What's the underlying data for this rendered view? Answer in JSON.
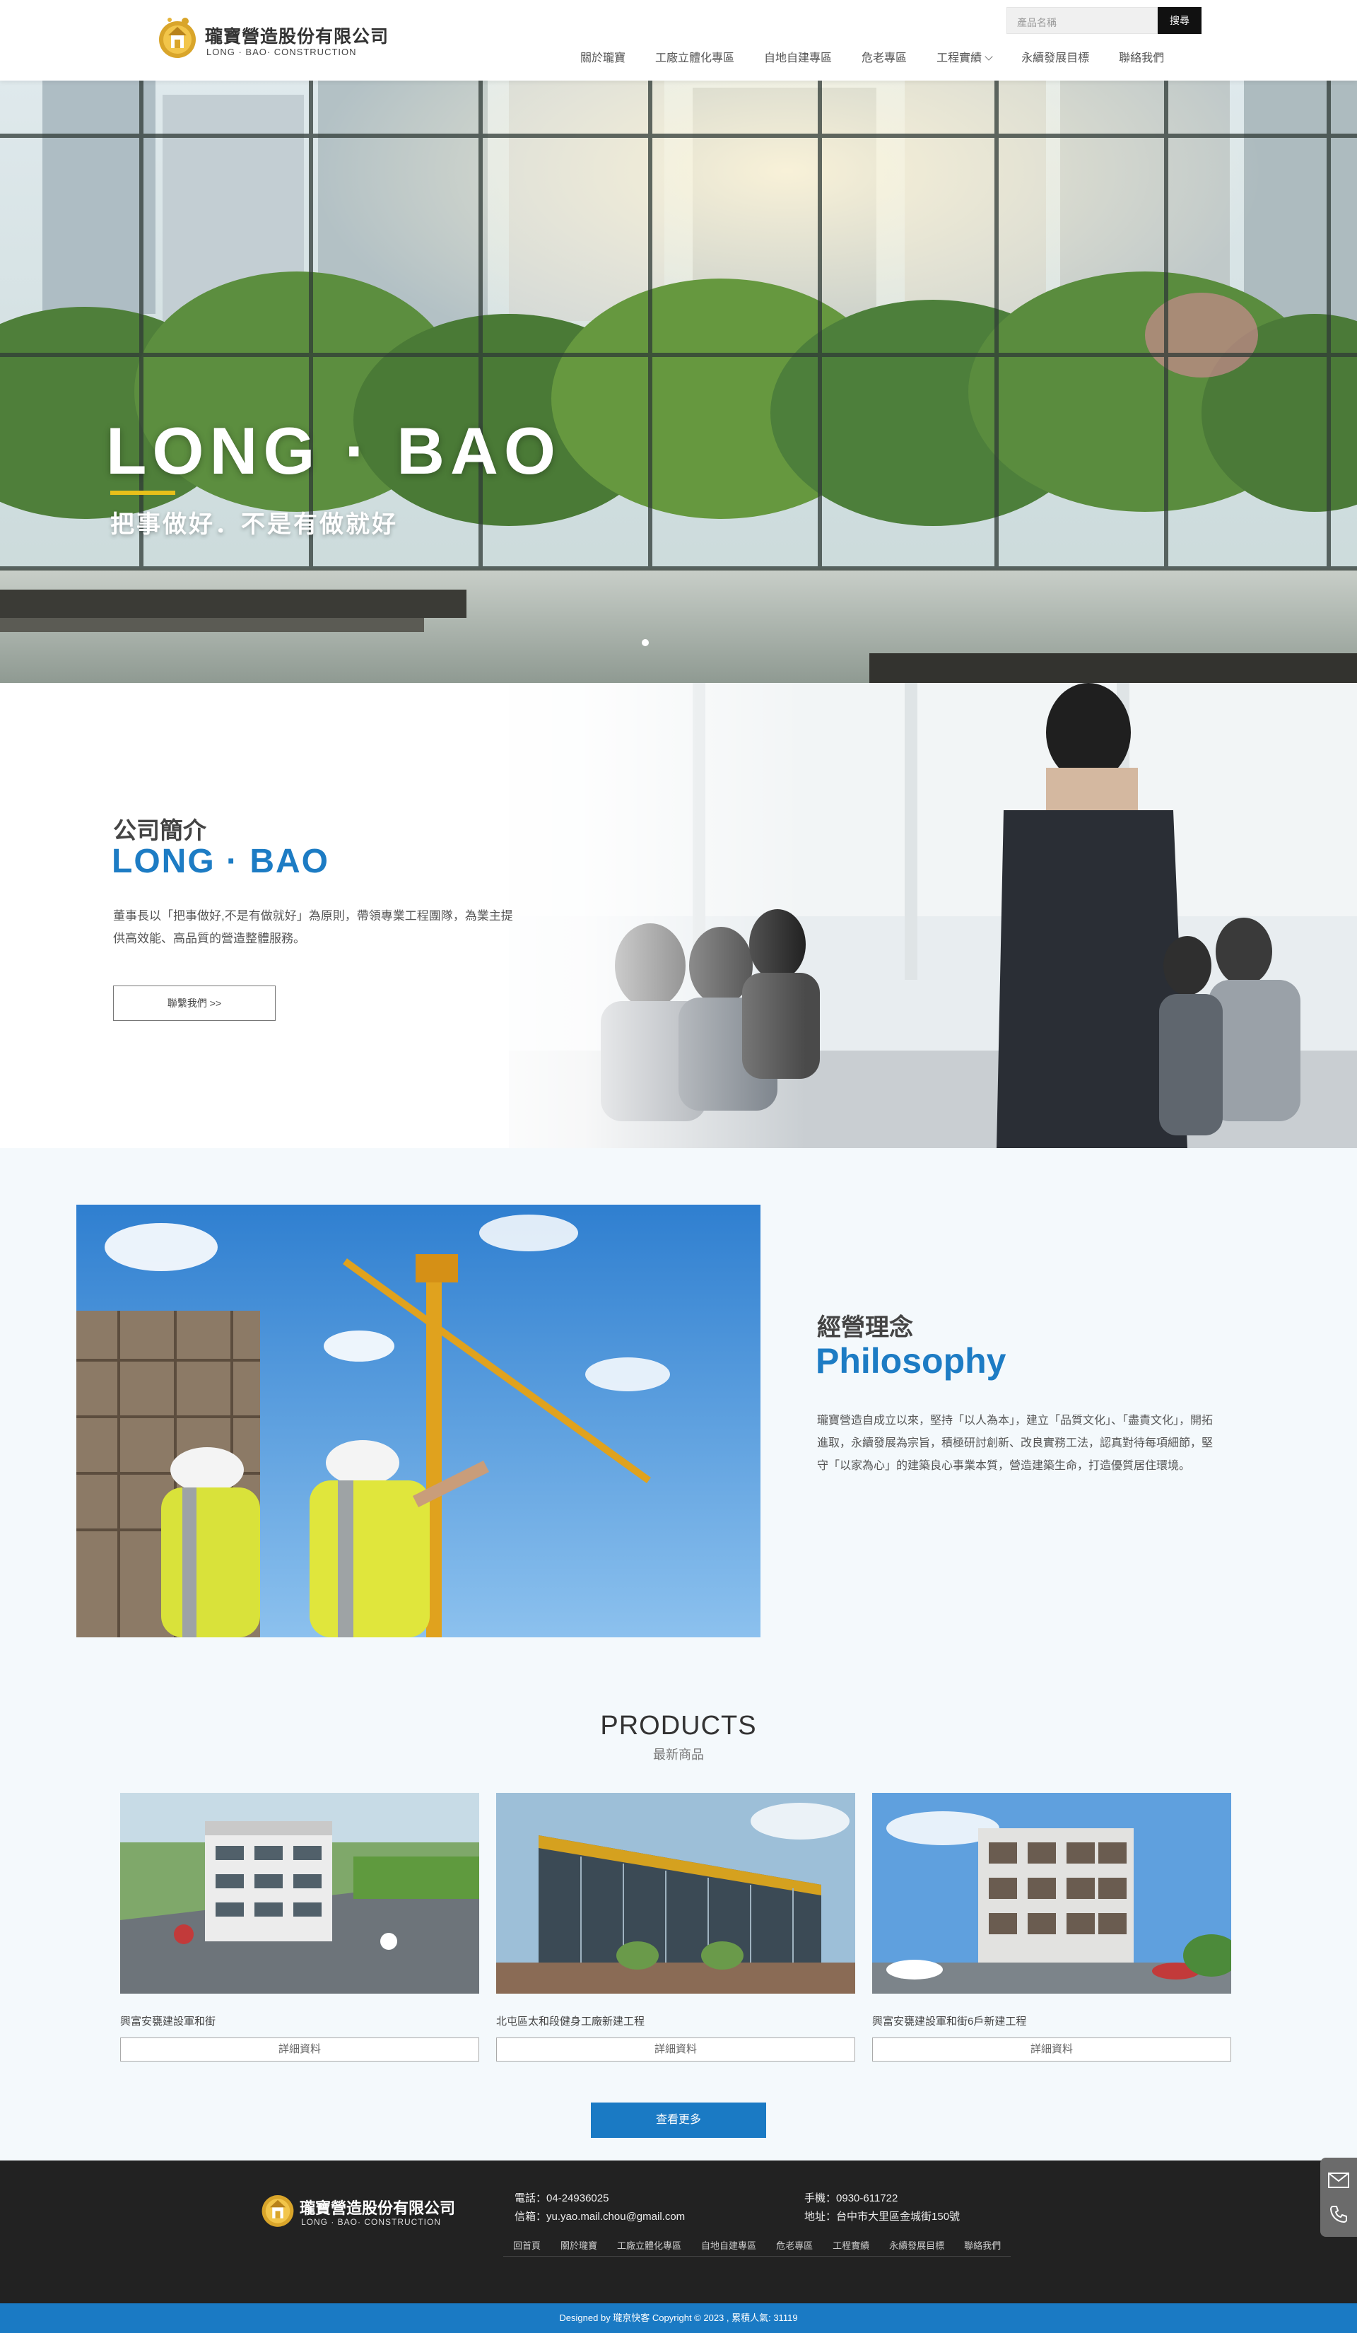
{
  "header": {
    "logo_name": "瓏寶營造股份有限公司",
    "logo_sub": "LONG · BAO· CONSTRUCTION",
    "search_placeholder": "產品名稱",
    "search_button": "搜尋",
    "nav": [
      {
        "label": "關於瓏寶"
      },
      {
        "label": "工廠立體化專區"
      },
      {
        "label": "自地自建專區"
      },
      {
        "label": "危老專區"
      },
      {
        "label": "工程實績"
      },
      {
        "label": "永續發展目標"
      },
      {
        "label": "聯絡我們"
      }
    ]
  },
  "hero": {
    "title": "LONG · BAO",
    "subtitle": "把事做好．不是有做就好",
    "accent_color": "#e8c01a"
  },
  "intro": {
    "heading": "公司簡介",
    "heading_en": "LONG · BAO",
    "text": "董事長以「把事做好,不是有做就好」為原則，帶領專業工程團隊，為業主提供高效能、高品質的營造整體服務。",
    "button": "聯繫我們 >>"
  },
  "philosophy": {
    "heading": "經營理念",
    "heading_en": "Philosophy",
    "text": "瓏寶營造自成立以來，堅持「以人為本」，建立「品質文化」、「盡責文化」，開拓進取，永續發展為宗旨，積極研討創新、改良實務工法，認真對待每項細節，堅守「以家為心」的建築良心事業本質，營造建築生命，打造優質居住環境。"
  },
  "products": {
    "title": "PRODUCTS",
    "subtitle": "最新商品",
    "items": [
      {
        "name": "興富安甕建設軍和街",
        "button": "詳細資料"
      },
      {
        "name": "北屯區太和段健身工廠新建工程",
        "button": "詳細資料"
      },
      {
        "name": "興富安甕建設軍和街6戶新建工程",
        "button": "詳細資料"
      }
    ],
    "more_button": "查看更多"
  },
  "footer": {
    "logo_name": "瓏寶營造股份有限公司",
    "logo_sub": "LONG · BAO· CONSTRUCTION",
    "phone_label": "電話：",
    "phone": "04-24936025",
    "email_label": "信箱：",
    "email": "yu.yao.mail.chou@gmail.com",
    "mobile_label": "手機：",
    "mobile": "0930-611722",
    "address_label": "地址：",
    "address": "台中市大里區金城街150號",
    "nav": [
      {
        "label": "回首頁"
      },
      {
        "label": "關於瓏寶"
      },
      {
        "label": "工廠立體化專區"
      },
      {
        "label": "自地自建專區"
      },
      {
        "label": "危老專區"
      },
      {
        "label": "工程實績"
      },
      {
        "label": "永續發展目標"
      },
      {
        "label": "聯絡我們"
      }
    ],
    "copyright": "Designed by 瓏京快客 Copyright © 2023 , 累積人氣: 31119"
  },
  "colors": {
    "brand_blue": "#1d7cc4",
    "footer_bg": "#222222",
    "copyright_bg": "#1a7ac4"
  },
  "icons": {
    "side_tools": [
      "mail-icon",
      "phone-icon"
    ]
  }
}
